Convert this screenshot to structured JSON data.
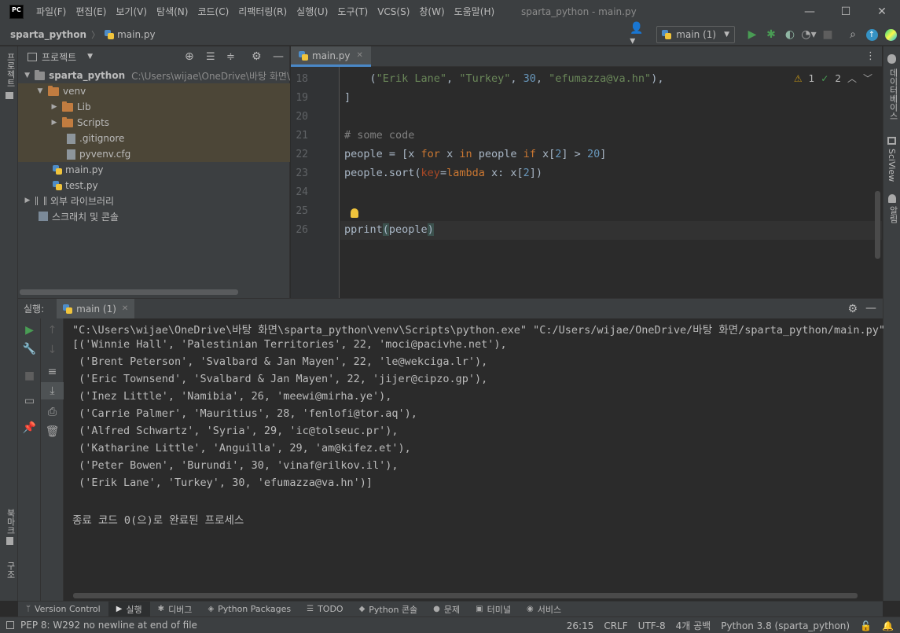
{
  "titlebar": {
    "logo_text": "PC",
    "menu": [
      "파일(F)",
      "편집(E)",
      "보기(V)",
      "탐색(N)",
      "코드(C)",
      "리팩터링(R)",
      "실행(U)",
      "도구(T)",
      "VCS(S)",
      "창(W)",
      "도움말(H)"
    ],
    "title": "sparta_python - main.py",
    "min": "—",
    "max": "☐",
    "close": "✕"
  },
  "navbar": {
    "project": "sparta_python",
    "separator": "〉",
    "file": "main.py",
    "run_config": "main (1)"
  },
  "left_strip": {
    "project_tab": "프로젝트",
    "bookmarks_tab": "북마크",
    "structure_tab": "구조"
  },
  "right_strip": {
    "database_tab": "데이터베이스",
    "sciview_tab": "SciView",
    "notifications_tab": "알림"
  },
  "project_panel": {
    "title": "프로젝트",
    "tree": [
      {
        "label": "sparta_python",
        "hint": "C:\\Users\\wijae\\OneDrive\\바탕 화면\\"
      },
      {
        "label": "venv"
      },
      {
        "label": "Lib"
      },
      {
        "label": "Scripts"
      },
      {
        "label": ".gitignore"
      },
      {
        "label": "pyvenv.cfg"
      },
      {
        "label": "main.py"
      },
      {
        "label": "test.py"
      },
      {
        "label": "외부 라이브러리"
      },
      {
        "label": "스크래치 및 콘솔"
      }
    ]
  },
  "editor": {
    "tab_label": "main.py",
    "inspection": {
      "warnings": "1",
      "weak_warnings": "2"
    },
    "line_numbers": [
      "18",
      "19",
      "20",
      "21",
      "22",
      "23",
      "24",
      "25",
      "26"
    ]
  },
  "run_panel": {
    "label": "실행:",
    "tab": "main (1)",
    "output": [
      "\"C:\\Users\\wijae\\OneDrive\\바탕 화면\\sparta_python\\venv\\Scripts\\python.exe\" \"C:/Users/wijae/OneDrive/바탕 화면/sparta_python/main.py\"",
      "[('Winnie Hall', 'Palestinian Territories', 22, 'moci@pacivhe.net'),",
      " ('Brent Peterson', 'Svalbard & Jan Mayen', 22, 'le@wekciga.lr'),",
      " ('Eric Townsend', 'Svalbard & Jan Mayen', 22, 'jijer@cipzo.gp'),",
      " ('Inez Little', 'Namibia', 26, 'meewi@mirha.ye'),",
      " ('Carrie Palmer', 'Mauritius', 28, 'fenlofi@tor.aq'),",
      " ('Alfred Schwartz', 'Syria', 29, 'ic@tolseuc.pr'),",
      " ('Katharine Little', 'Anguilla', 29, 'am@kifez.et'),",
      " ('Peter Bowen', 'Burundi', 30, 'vinaf@rilkov.il'),",
      " ('Erik Lane', 'Turkey', 30, 'efumazza@va.hn')]",
      "",
      "종료 코드 0(으)로 완료된 프로세스"
    ]
  },
  "bottom_tabs": [
    "Version Control",
    "실행",
    "디버그",
    "Python Packages",
    "TODO",
    "Python 콘솔",
    "문제",
    "터미널",
    "서비스"
  ],
  "statusbar": {
    "message": "PEP 8: W292 no newline at end of file",
    "position": "26:15",
    "line_sep": "CRLF",
    "encoding": "UTF-8",
    "indent": "4개 공백",
    "interpreter": "Python 3.8 (sparta_python)"
  }
}
